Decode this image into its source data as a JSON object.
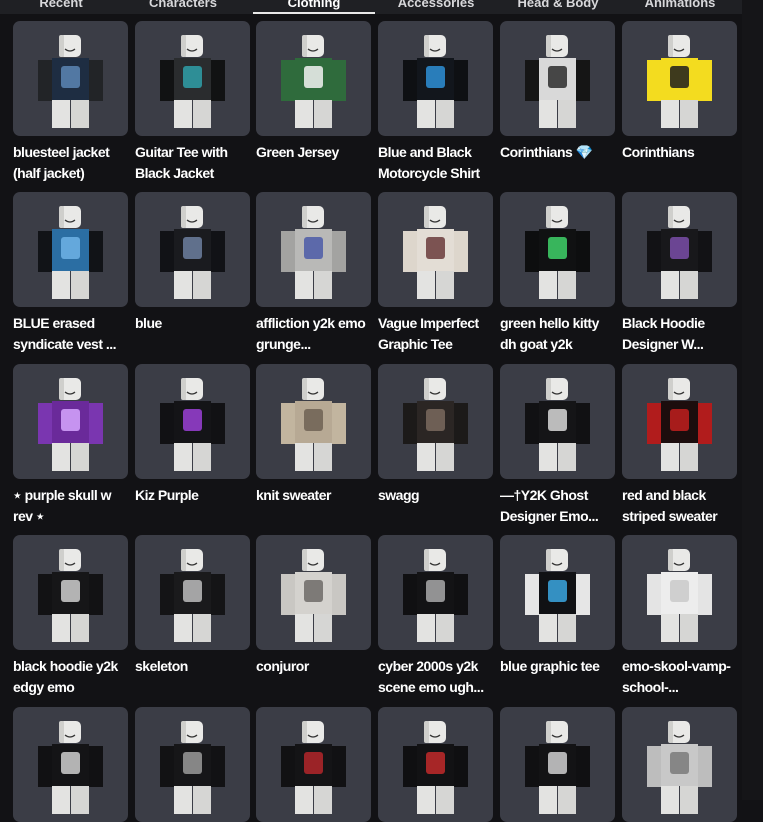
{
  "tabs": [
    {
      "label": "Recent",
      "active": false
    },
    {
      "label": "Characters",
      "active": false
    },
    {
      "label": "Clothing",
      "active": true
    },
    {
      "label": "Accessories",
      "active": false
    },
    {
      "label": "Head & Body",
      "active": false
    },
    {
      "label": "Animations",
      "active": false
    }
  ],
  "items": [
    {
      "name": "bluesteel jacket (half jacket)",
      "colors": {
        "body": "#1e2d42",
        "sleeve": "#222427",
        "accent": "#5c86b4"
      }
    },
    {
      "name": "Guitar Tee with Black Jacket",
      "colors": {
        "body": "#2a2c2e",
        "sleeve": "#111213",
        "accent": "#2fa0a8"
      }
    },
    {
      "name": "Green Jersey",
      "colors": {
        "body": "#2f6b3c",
        "sleeve": "#2f6b3c",
        "accent": "#f2f2f2"
      }
    },
    {
      "name": "Blue and Black Motorcycle Shirt",
      "colors": {
        "body": "#12161c",
        "sleeve": "#0e1013",
        "accent": "#2e8fd6"
      }
    },
    {
      "name": "Corinthians 💎",
      "colors": {
        "body": "#d9d9d9",
        "sleeve": "#151515",
        "accent": "#2b2b2b"
      }
    },
    {
      "name": "Corinthians",
      "colors": {
        "body": "#f3dc1f",
        "sleeve": "#f3dc1f",
        "accent": "#1d1d1d"
      }
    },
    {
      "name": "BLUE erased syndicate vest ...",
      "colors": {
        "body": "#2b6ea3",
        "sleeve": "#111317",
        "accent": "#6fb3e6"
      }
    },
    {
      "name": "blue",
      "colors": {
        "body": "#1a1b1f",
        "sleeve": "#111216",
        "accent": "#6d7fa0"
      }
    },
    {
      "name": "affliction y2k emo grunge...",
      "colors": {
        "body": "#b9b9b7",
        "sleeve": "#a3a3a1",
        "accent": "#4b5aa8"
      }
    },
    {
      "name": "Vague Imperfect Graphic Tee",
      "colors": {
        "body": "#e3ddd5",
        "sleeve": "#ddd6cc",
        "accent": "#6a3b3b"
      }
    },
    {
      "name": "green hello kitty dh goat y2k",
      "colors": {
        "body": "#101112",
        "sleeve": "#0d0e0f",
        "accent": "#3fd26a"
      }
    },
    {
      "name": "Black Hoodie Designer W...",
      "colors": {
        "body": "#18181b",
        "sleeve": "#121215",
        "accent": "#7a4ea8"
      }
    },
    {
      "name": "⋆ purple skull w rev ⋆",
      "colors": {
        "body": "#6a2a9a",
        "sleeve": "#7a36b0",
        "accent": "#d6a6ff"
      }
    },
    {
      "name": "Kiz Purple",
      "colors": {
        "body": "#141417",
        "sleeve": "#111114",
        "accent": "#9a3fd6"
      }
    },
    {
      "name": "knit sweater",
      "colors": {
        "body": "#b7a994",
        "sleeve": "#c2b59f",
        "accent": "#6e6254"
      }
    },
    {
      "name": "swagg",
      "colors": {
        "body": "#2b2624",
        "sleeve": "#1c1a19",
        "accent": "#7a6a5e"
      }
    },
    {
      "name": "—†Y2K Ghost Designer Emo...",
      "colors": {
        "body": "#151517",
        "sleeve": "#111113",
        "accent": "#d8d8d8"
      }
    },
    {
      "name": "red and black striped sweater",
      "colors": {
        "body": "#1c0d0d",
        "sleeve": "#b11c1c",
        "accent": "#c0201f"
      }
    },
    {
      "name": "black hoodie y2k edgy emo",
      "colors": {
        "body": "#161618",
        "sleeve": "#121214",
        "accent": "#cfcfcf"
      }
    },
    {
      "name": "skeleton",
      "colors": {
        "body": "#1a1a1c",
        "sleeve": "#141416",
        "accent": "#bdbdbd"
      }
    },
    {
      "name": "conjuror",
      "colors": {
        "body": "#d4d2ce",
        "sleeve": "#c9c7c3",
        "accent": "#6d6b67"
      }
    },
    {
      "name": "cyber 2000s y2k scene emo ugh...",
      "colors": {
        "body": "#131315",
        "sleeve": "#101012",
        "accent": "#a9a9a9"
      }
    },
    {
      "name": "blue graphic tee",
      "colors": {
        "body": "#101114",
        "sleeve": "#e6e6e6",
        "accent": "#3ba7e0"
      }
    },
    {
      "name": "emo-skool-vamp-school-...",
      "colors": {
        "body": "#ededed",
        "sleeve": "#e4e4e4",
        "accent": "#c9c9c9"
      }
    },
    {
      "name": "",
      "colors": {
        "body": "#141416",
        "sleeve": "#111113",
        "accent": "#cfcfcf"
      }
    },
    {
      "name": "",
      "colors": {
        "body": "#161618",
        "sleeve": "#121214",
        "accent": "#9a9a9a"
      }
    },
    {
      "name": "",
      "colors": {
        "body": "#141416",
        "sleeve": "#111113",
        "accent": "#b3262a"
      }
    },
    {
      "name": "",
      "colors": {
        "body": "#121214",
        "sleeve": "#0f0f11",
        "accent": "#c22a2a"
      }
    },
    {
      "name": "",
      "colors": {
        "body": "#131315",
        "sleeve": "#101012",
        "accent": "#d0d0d0"
      }
    },
    {
      "name": "",
      "colors": {
        "body": "#c8c8c8",
        "sleeve": "#bdbdbd",
        "accent": "#7a7a7a"
      }
    }
  ]
}
